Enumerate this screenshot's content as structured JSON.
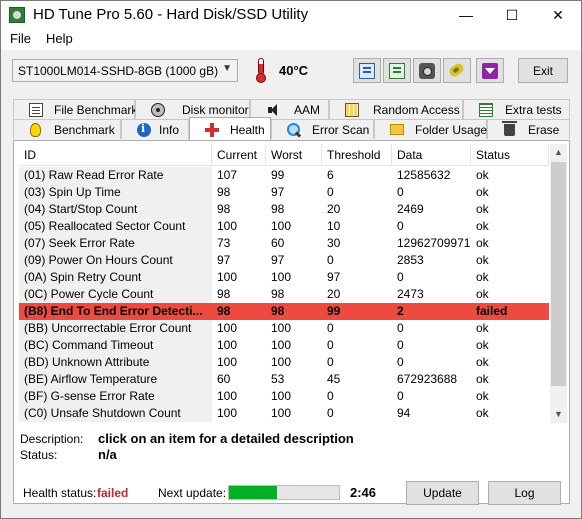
{
  "window": {
    "title": "HD Tune Pro 5.60 - Hard Disk/SSD Utility",
    "min_glyph": "—",
    "max_glyph": "☐",
    "close_glyph": "✕"
  },
  "menu": {
    "file": "File",
    "help": "Help"
  },
  "toolbar": {
    "drive": "ST1000LM014-SSHD-8GB (1000 gB)",
    "temperature": "40°C",
    "exit_label": "Exit",
    "icons": [
      "copy-text-icon",
      "copy-info-icon",
      "screenshot-camera-icon",
      "options-keys-icon",
      "save-download-icon"
    ]
  },
  "tabs": {
    "top": [
      {
        "label": "File Benchmark",
        "icon": "file-benchmark-icon"
      },
      {
        "label": "Disk monitor",
        "icon": "disk-monitor-icon"
      },
      {
        "label": "AAM",
        "icon": "speaker-icon"
      },
      {
        "label": "Random Access",
        "icon": "random-access-icon"
      },
      {
        "label": "Extra tests",
        "icon": "extra-tests-icon"
      }
    ],
    "bottom": [
      {
        "label": "Benchmark",
        "icon": "benchmark-bulb-icon"
      },
      {
        "label": "Info",
        "icon": "info-icon"
      },
      {
        "label": "Health",
        "icon": "health-cross-icon"
      },
      {
        "label": "Error Scan",
        "icon": "magnifier-icon"
      },
      {
        "label": "Folder Usage",
        "icon": "folder-icon"
      },
      {
        "label": "Erase",
        "icon": "trash-icon"
      }
    ],
    "active": "Health"
  },
  "health_table": {
    "columns": [
      "ID",
      "Current",
      "Worst",
      "Threshold",
      "Data",
      "Status"
    ],
    "rows": [
      {
        "id": "(01) Raw Read Error Rate",
        "current": "107",
        "worst": "99",
        "threshold": "6",
        "data": "12585632",
        "status": "ok"
      },
      {
        "id": "(03) Spin Up Time",
        "current": "98",
        "worst": "97",
        "threshold": "0",
        "data": "0",
        "status": "ok"
      },
      {
        "id": "(04) Start/Stop Count",
        "current": "98",
        "worst": "98",
        "threshold": "20",
        "data": "2469",
        "status": "ok"
      },
      {
        "id": "(05) Reallocated Sector Count",
        "current": "100",
        "worst": "100",
        "threshold": "10",
        "data": "0",
        "status": "ok"
      },
      {
        "id": "(07) Seek Error Rate",
        "current": "73",
        "worst": "60",
        "threshold": "30",
        "data": "12962709971",
        "status": "ok"
      },
      {
        "id": "(09) Power On Hours Count",
        "current": "97",
        "worst": "97",
        "threshold": "0",
        "data": "2853",
        "status": "ok"
      },
      {
        "id": "(0A) Spin Retry Count",
        "current": "100",
        "worst": "100",
        "threshold": "97",
        "data": "0",
        "status": "ok"
      },
      {
        "id": "(0C) Power Cycle Count",
        "current": "98",
        "worst": "98",
        "threshold": "20",
        "data": "2473",
        "status": "ok"
      },
      {
        "id": "(B8) End To End Error Detecti...",
        "current": "98",
        "worst": "98",
        "threshold": "99",
        "data": "2",
        "status": "failed"
      },
      {
        "id": "(BB) Uncorrectable Error Count",
        "current": "100",
        "worst": "100",
        "threshold": "0",
        "data": "0",
        "status": "ok"
      },
      {
        "id": "(BC) Command Timeout",
        "current": "100",
        "worst": "100",
        "threshold": "0",
        "data": "0",
        "status": "ok"
      },
      {
        "id": "(BD) Unknown Attribute",
        "current": "100",
        "worst": "100",
        "threshold": "0",
        "data": "0",
        "status": "ok"
      },
      {
        "id": "(BE) Airflow Temperature",
        "current": "60",
        "worst": "53",
        "threshold": "45",
        "data": "672923688",
        "status": "ok"
      },
      {
        "id": "(BF) G-sense Error Rate",
        "current": "100",
        "worst": "100",
        "threshold": "0",
        "data": "0",
        "status": "ok"
      },
      {
        "id": "(C0) Unsafe Shutdown Count",
        "current": "100",
        "worst": "100",
        "threshold": "0",
        "data": "94",
        "status": "ok"
      }
    ]
  },
  "details": {
    "description_label": "Description:",
    "description_value": "click on an item for a detailed description",
    "status_label": "Status:",
    "status_value": "n/a"
  },
  "footer": {
    "health_status_label": "Health status:",
    "health_status_value": "failed",
    "next_update_label": "Next update:",
    "progress_fraction": 0.44,
    "countdown": "2:46",
    "update_label": "Update",
    "log_label": "Log"
  },
  "colors": {
    "failed_row": "#ef4a3f",
    "progress": "#06b025",
    "failed_text": "#c62828"
  }
}
